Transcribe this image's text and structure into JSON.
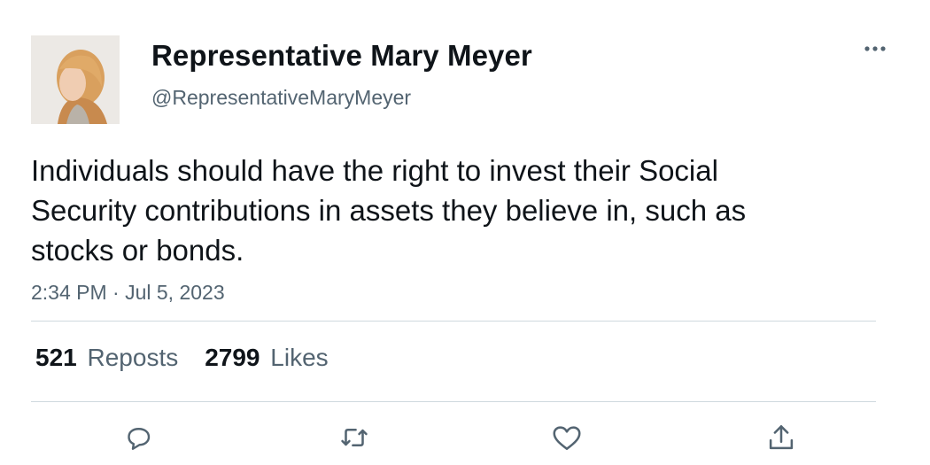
{
  "user": {
    "display_name": "Representative Mary Meyer",
    "handle": "@RepresentativeMaryMeyer"
  },
  "tweet": {
    "text": "Individuals should have the right to invest their Social Security contributions in assets they believe in, such as stocks or bonds.",
    "timestamp": "2:34 PM · Jul 5, 2023"
  },
  "stats": {
    "reposts_count": "521",
    "reposts_label": "Reposts",
    "likes_count": "2799",
    "likes_label": "Likes"
  },
  "actions": {
    "reply_icon": "reply-icon",
    "repost_icon": "repost-icon",
    "like_icon": "heart-icon",
    "share_icon": "share-icon"
  },
  "colors": {
    "text": "#0f1419",
    "secondary": "#536471",
    "divider": "#cfd9de"
  }
}
